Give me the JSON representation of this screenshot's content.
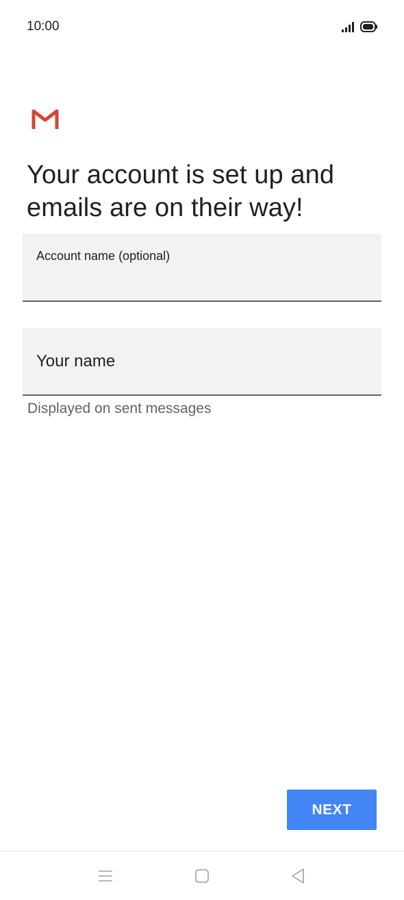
{
  "status_bar": {
    "time": "10:00",
    "icons": [
      "signal-icon",
      "battery-icon"
    ]
  },
  "app": {
    "logo": "gmail-logo"
  },
  "headline": "Your account is set up and emails are on their way!",
  "form": {
    "account_name": {
      "label": "Account name (optional)",
      "value": ""
    },
    "your_name": {
      "placeholder": "Your name",
      "helper": "Displayed on sent messages"
    }
  },
  "actions": {
    "next_label": "NEXT"
  },
  "nav_bar": {
    "buttons": [
      "menu-icon",
      "home-icon",
      "back-icon"
    ]
  },
  "colors": {
    "accent": "#4285f4",
    "field_bg": "#f1f2f4",
    "field_underline": "#5f6368",
    "gmail_red": "#d44638"
  }
}
